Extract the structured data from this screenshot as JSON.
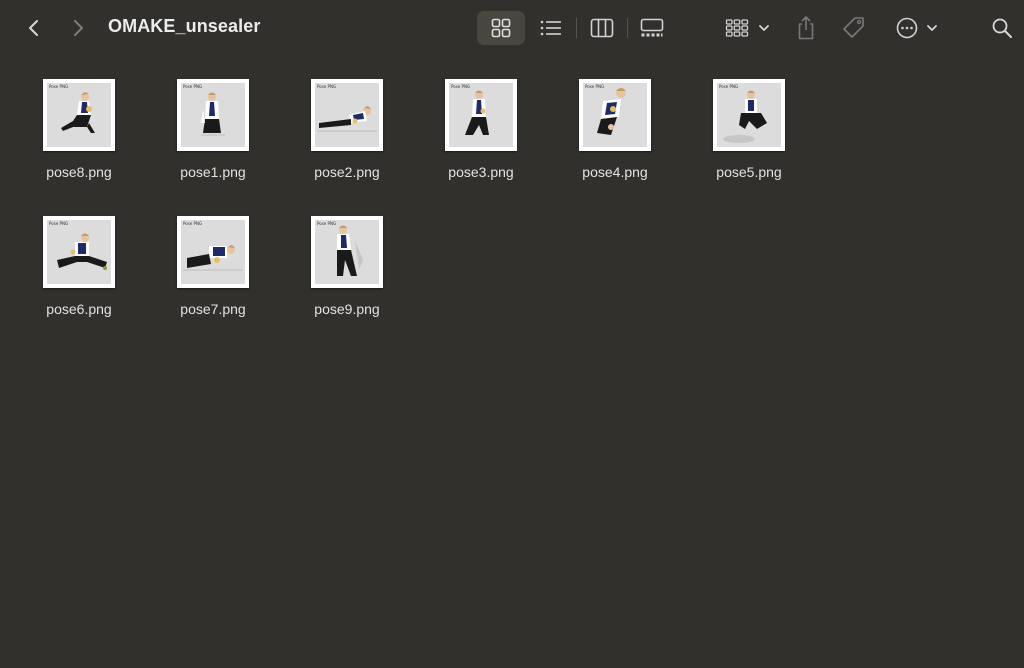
{
  "window": {
    "title": "OMAKE_unsealer"
  },
  "toolbar": {
    "back_icon": "chevron-left-icon",
    "forward_icon": "chevron-right-icon",
    "views": [
      {
        "name": "icon-view",
        "icon": "grid-icon",
        "active": true
      },
      {
        "name": "list-view",
        "icon": "list-icon",
        "active": false
      },
      {
        "name": "column-view",
        "icon": "columns-icon",
        "active": false
      },
      {
        "name": "gallery-view",
        "icon": "gallery-icon",
        "active": false
      }
    ],
    "group_icon": "group-grid-icon",
    "share_icon": "share-icon",
    "tag_icon": "tag-icon",
    "more_icon": "ellipsis-circle-icon",
    "search_icon": "search-icon"
  },
  "files": [
    {
      "name": "pose8.png",
      "thumb_caption": "Pose PNG"
    },
    {
      "name": "pose1.png",
      "thumb_caption": "Pose PNG"
    },
    {
      "name": "pose2.png",
      "thumb_caption": "Pose PNG"
    },
    {
      "name": "pose3.png",
      "thumb_caption": "Pose PNG"
    },
    {
      "name": "pose4.png",
      "thumb_caption": "Pose PNG"
    },
    {
      "name": "pose5.png",
      "thumb_caption": "Pose PNG"
    },
    {
      "name": "pose6.png",
      "thumb_caption": "Pose PNG"
    },
    {
      "name": "pose7.png",
      "thumb_caption": "Pose PNG"
    },
    {
      "name": "pose9.png",
      "thumb_caption": "Pose PNG"
    }
  ],
  "colors": {
    "background": "#31302c",
    "toolbar_active": "#48473f",
    "text": "#e2e2e2",
    "shirt": "#ffffff",
    "vest": "#1d2a6b",
    "pants": "#1a1a1a",
    "hair": "#c89a64"
  }
}
